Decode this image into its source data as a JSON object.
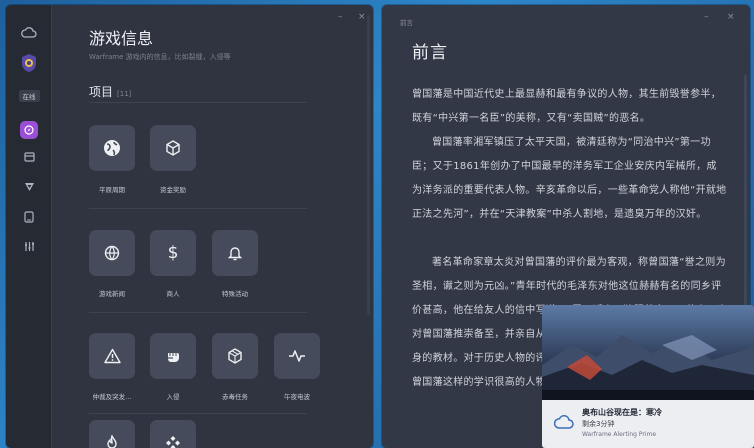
{
  "left_window": {
    "title": "游戏信息",
    "subtitle": "Warframe 游戏内的信息，比如裂缝，入侵等",
    "section": {
      "label": "项目",
      "count": "[11]"
    },
    "rail_status": "在线",
    "tiles_row1": [
      {
        "label": "平原周期",
        "icon": "globe-icon"
      },
      {
        "label": "资金奖励",
        "icon": "cube-icon"
      }
    ],
    "tiles_row2": [
      {
        "label": "游戏新闻",
        "icon": "globe-grid-icon"
      },
      {
        "label": "商人",
        "icon": "dollar-icon"
      },
      {
        "label": "特殊活动",
        "icon": "bell-icon"
      }
    ],
    "tiles_row3": [
      {
        "label": "仲裁及突发...",
        "icon": "warning-icon"
      },
      {
        "label": "入侵",
        "icon": "fist-icon"
      },
      {
        "label": "赤毒任务",
        "icon": "box-icon"
      },
      {
        "label": "午夜电波",
        "icon": "pulse-icon"
      }
    ],
    "tiles_row4": [
      {
        "label": "",
        "icon": "flame-icon"
      },
      {
        "label": "",
        "icon": "cross-icon"
      }
    ]
  },
  "right_window": {
    "small_title": "前言",
    "title": "前言",
    "paragraphs": [
      "曾国藩是中国近代史上最显赫和最有争议的人物，其生前毁誉参半，既有“中兴第一名臣”的美称，又有“卖国贼”的恶名。",
      "曾国藩率湘军镇压了太平天国，被清廷称为“同治中兴”第一功臣；又于1861年创办了中国最早的洋务军工企业安庆内军械所，成为洋务派的重要代表人物。辛亥革命以后，一些革命党人称他“开就地正法之先河”，并在“天津教案”中杀人割地，是遗臭万年的汉奸。",
      "著名革命家章太炎对曾国藩的评价最为客观，称曾国藩“誉之则为圣相，谳之则为元凶。”青年时代的毛泽东对他这位赫赫有名的同乡评价甚高，他在给友人的信中写道：“吾于近人，独服曾文正。”蒋介石也对曾国藩推崇备至，并亲自从《曾国藩家书》中选编部分内容作为修身的教材。对于历史人物的评价，是不能脱离他们所处的时代的。像曾国藩这样的学识很高的人物……"
    ]
  },
  "toast": {
    "line1": "奥布山谷现在是：寒冷",
    "line2": "剩余3分钟",
    "line3": "Warframe Alerting Prime"
  }
}
